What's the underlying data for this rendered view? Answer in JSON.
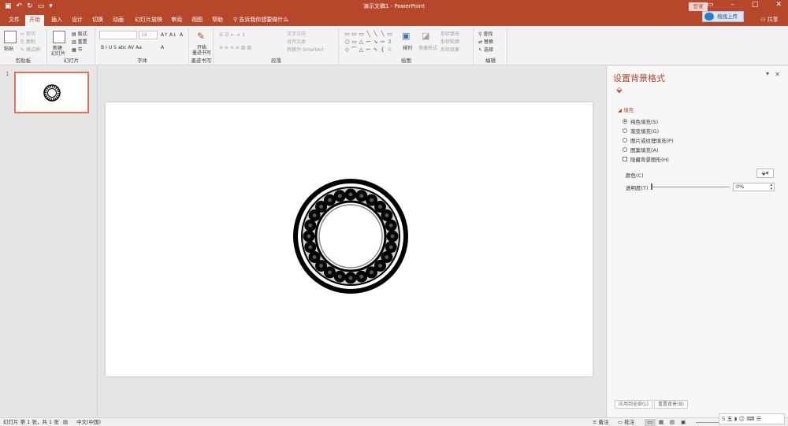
{
  "window": {
    "title": "演示文稿1 - PowerPoint",
    "login": "登录",
    "qat_icons": [
      "save-icon",
      "undo-icon",
      "redo-icon",
      "start-from-beginning-icon",
      "customize-icon"
    ],
    "win_controls": [
      "ribbon-display-icon",
      "minimize-icon",
      "maximize-icon",
      "close-icon"
    ]
  },
  "tabs": [
    "文件",
    "开始",
    "插入",
    "设计",
    "切换",
    "动画",
    "幻灯片放映",
    "审阅",
    "视图",
    "帮助"
  ],
  "tell_me": "告诉我你想要做什么",
  "upload": "拖拽上传",
  "share": "共享",
  "ribbon": {
    "clipboard": {
      "label": "剪贴板",
      "paste": "粘贴",
      "cut": "剪切",
      "copy": "复制",
      "format_painter": "格式刷"
    },
    "slides": {
      "label": "幻灯片",
      "new_slide": "新建",
      "new_slide2": "幻灯片",
      "layout": "版式",
      "reset": "重置",
      "section": "节"
    },
    "font": {
      "label": "字体",
      "size": "18"
    },
    "ink": {
      "label": "墨迹书写",
      "start": "开始",
      "start2": "墨迹书写"
    },
    "paragraph": {
      "label": "段落",
      "text_direction": "文字方向",
      "align_text": "对齐文本",
      "smartart": "转换为 SmartArt"
    },
    "drawing": {
      "label": "绘图",
      "arrange": "排列",
      "quick_styles": "快速样式",
      "shape_fill": "形状填充",
      "shape_outline": "形状轮廓",
      "shape_effects": "形状效果"
    },
    "editing": {
      "label": "编辑",
      "find": "查找",
      "replace": "替换",
      "select": "选择"
    }
  },
  "thumbnails": [
    {
      "number": "1"
    }
  ],
  "format_pane": {
    "title": "设置背景格式",
    "section": "填充",
    "options": [
      "纯色填充(S)",
      "渐变填充(G)",
      "图片或纹理填充(P)",
      "图案填充(A)"
    ],
    "selected_option": 0,
    "hide_graphics": "隐藏背景图形(H)",
    "color_label": "颜色(C)",
    "transparency_label": "透明度(T)",
    "transparency_value": "0%",
    "transparency_level": 0,
    "apply_all": "应用到全部(L)",
    "reset_bg": "重置背景(B)"
  },
  "status": {
    "slide_info": "幻灯片 第 1 张，共 1 张",
    "language": "中文(中国)",
    "notes": "备注",
    "comments": "批注"
  },
  "ime": {
    "label": "五"
  },
  "bearing": {
    "balls": 24,
    "stroke": "#000000"
  }
}
